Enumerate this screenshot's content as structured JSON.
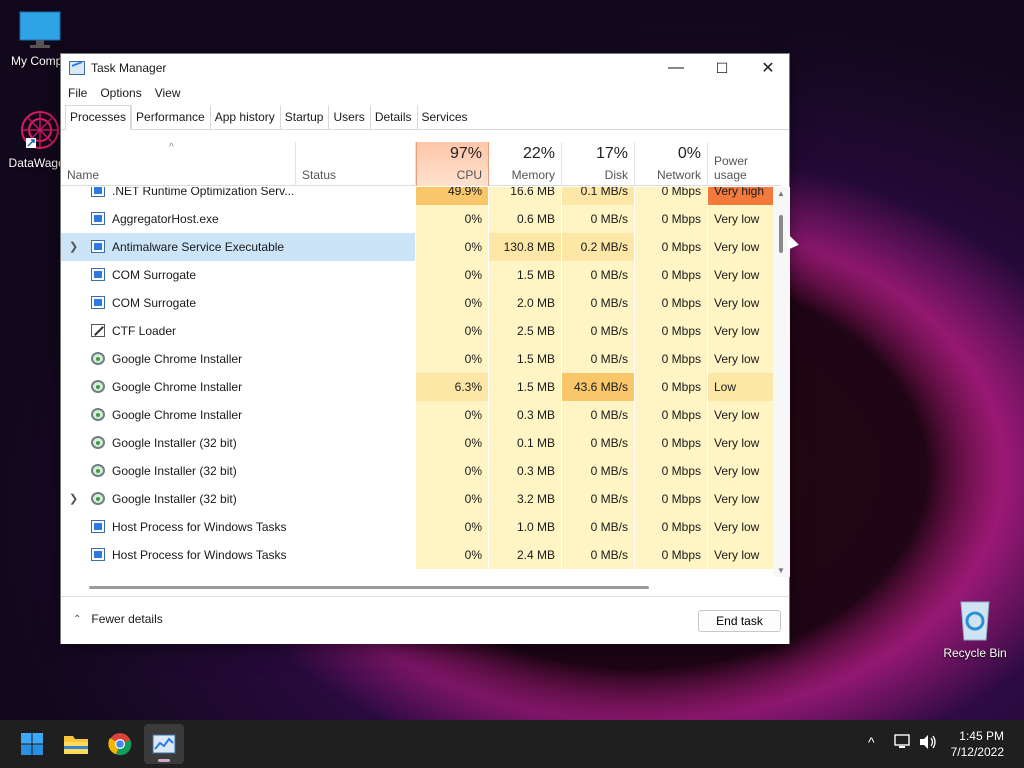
{
  "desktop": {
    "icons": [
      {
        "label": "My Compu",
        "icon": "monitor-icon"
      },
      {
        "label": "DataWagon",
        "icon": "datawagon-shortcut-icon"
      },
      {
        "label": "Recycle Bin",
        "icon": "recycle-bin-icon"
      }
    ]
  },
  "window": {
    "title": "Task Manager",
    "controls": {
      "minimize": "—",
      "maximize": "☐",
      "close": "✕"
    },
    "menu": [
      "File",
      "Options",
      "View"
    ],
    "tabs": [
      "Processes",
      "Performance",
      "App history",
      "Startup",
      "Users",
      "Details",
      "Services"
    ],
    "active_tab": "Processes"
  },
  "table": {
    "sort_arrow": "^",
    "headers": {
      "name": "Name",
      "status": "Status",
      "cpu": {
        "pct": "97%",
        "label": "CPU"
      },
      "memory": {
        "pct": "22%",
        "label": "Memory"
      },
      "disk": {
        "pct": "17%",
        "label": "Disk"
      },
      "network": {
        "pct": "0%",
        "label": "Network"
      },
      "power": "Power usage"
    },
    "rows": [
      {
        "name": ".NET Runtime Optimization Serv...",
        "icon": "win",
        "expand": false,
        "cpu": "49.9%",
        "mem": "16.6 MB",
        "disk": "0.1 MB/s",
        "net": "0 Mbps",
        "power": "Very high",
        "selected": false
      },
      {
        "name": "AggregatorHost.exe",
        "icon": "win",
        "expand": false,
        "cpu": "0%",
        "mem": "0.6 MB",
        "disk": "0 MB/s",
        "net": "0 Mbps",
        "power": "Very low",
        "selected": false
      },
      {
        "name": "Antimalware Service Executable",
        "icon": "win",
        "expand": true,
        "cpu": "0%",
        "mem": "130.8 MB",
        "disk": "0.2 MB/s",
        "net": "0 Mbps",
        "power": "Very low",
        "selected": true
      },
      {
        "name": "COM Surrogate",
        "icon": "win",
        "expand": false,
        "cpu": "0%",
        "mem": "1.5 MB",
        "disk": "0 MB/s",
        "net": "0 Mbps",
        "power": "Very low",
        "selected": false
      },
      {
        "name": "COM Surrogate",
        "icon": "win",
        "expand": false,
        "cpu": "0%",
        "mem": "2.0 MB",
        "disk": "0 MB/s",
        "net": "0 Mbps",
        "power": "Very low",
        "selected": false
      },
      {
        "name": "CTF Loader",
        "icon": "ctf",
        "expand": false,
        "cpu": "0%",
        "mem": "2.5 MB",
        "disk": "0 MB/s",
        "net": "0 Mbps",
        "power": "Very low",
        "selected": false
      },
      {
        "name": "Google Chrome Installer",
        "icon": "gear",
        "expand": false,
        "cpu": "0%",
        "mem": "1.5 MB",
        "disk": "0 MB/s",
        "net": "0 Mbps",
        "power": "Very low",
        "selected": false
      },
      {
        "name": "Google Chrome Installer",
        "icon": "gear",
        "expand": false,
        "cpu": "6.3%",
        "mem": "1.5 MB",
        "disk": "43.6 MB/s",
        "net": "0 Mbps",
        "power": "Low",
        "selected": false
      },
      {
        "name": "Google Chrome Installer",
        "icon": "gear",
        "expand": false,
        "cpu": "0%",
        "mem": "0.3 MB",
        "disk": "0 MB/s",
        "net": "0 Mbps",
        "power": "Very low",
        "selected": false
      },
      {
        "name": "Google Installer (32 bit)",
        "icon": "gear",
        "expand": false,
        "cpu": "0%",
        "mem": "0.1 MB",
        "disk": "0 MB/s",
        "net": "0 Mbps",
        "power": "Very low",
        "selected": false
      },
      {
        "name": "Google Installer (32 bit)",
        "icon": "gear",
        "expand": false,
        "cpu": "0%",
        "mem": "0.3 MB",
        "disk": "0 MB/s",
        "net": "0 Mbps",
        "power": "Very low",
        "selected": false
      },
      {
        "name": "Google Installer (32 bit)",
        "icon": "gear",
        "expand": true,
        "cpu": "0%",
        "mem": "3.2 MB",
        "disk": "0 MB/s",
        "net": "0 Mbps",
        "power": "Very low",
        "selected": false
      },
      {
        "name": "Host Process for Windows Tasks",
        "icon": "win",
        "expand": false,
        "cpu": "0%",
        "mem": "1.0 MB",
        "disk": "0 MB/s",
        "net": "0 Mbps",
        "power": "Very low",
        "selected": false
      },
      {
        "name": "Host Process for Windows Tasks",
        "icon": "win",
        "expand": false,
        "cpu": "0%",
        "mem": "2.4 MB",
        "disk": "0 MB/s",
        "net": "0 Mbps",
        "power": "Very low",
        "selected": false
      }
    ]
  },
  "footer": {
    "fewer_details": "Fewer details",
    "end_task": "End task"
  },
  "taskbar": {
    "apps": [
      "start-icon",
      "file-explorer-icon",
      "chrome-icon",
      "task-manager-icon"
    ],
    "time": "1:45 PM",
    "date": "7/12/2022"
  },
  "colors": {
    "cpu_header": "#ffc6a8",
    "heat_low": "#fff4c4",
    "heat_mid": "#fde7a6",
    "heat_high": "#f9c76a",
    "power_very_high": "#f27a3c",
    "selected_row": "#cce4f7"
  }
}
